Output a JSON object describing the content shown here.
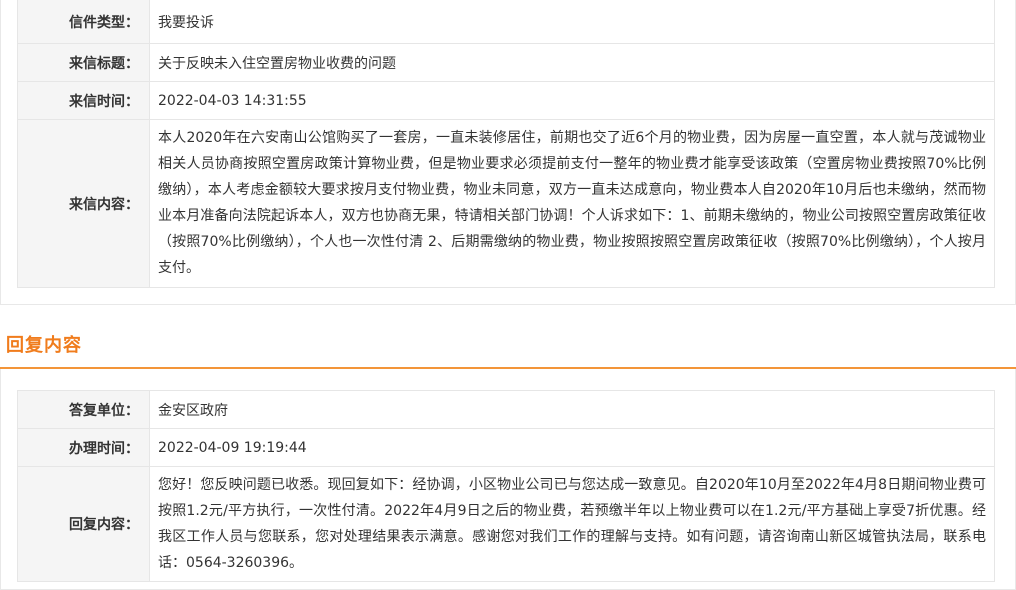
{
  "letter": {
    "type_label": "信件类型：",
    "type_value": "我要投诉",
    "title_label": "来信标题：",
    "title_value": "关于反映未入住空置房物业收费的问题",
    "time_label": "来信时间：",
    "time_value": "2022-04-03 14:31:55",
    "content_label": "来信内容：",
    "content_value": "本人2020年在六安南山公馆购买了一套房，一直未装修居住，前期也交了近6个月的物业费，因为房屋一直空置，本人就与茂诚物业相关人员协商按照空置房政策计算物业费，但是物业要求必须提前支付一整年的物业费才能享受该政策（空置房物业费按照70%比例缴纳），本人考虑金额较大要求按月支付物业费，物业未同意，双方一直未达成意向，物业费本人自2020年10月后也未缴纳，然而物业本月准备向法院起诉本人，双方也协商无果，特请相关部门协调！个人诉求如下：1、前期未缴纳的，物业公司按照空置房政策征收（按照70%比例缴纳），个人也一次性付清 2、后期需缴纳的物业费，物业按照按照空置房政策征收（按照70%比例缴纳），个人按月支付。"
  },
  "reply": {
    "section_title": "回复内容",
    "unit_label": "答复单位：",
    "unit_value": "金安区政府",
    "time_label": "办理时间：",
    "time_value": "2022-04-09 19:19:44",
    "content_label": "回复内容：",
    "content_value": "您好！您反映问题已收悉。现回复如下：经协调，小区物业公司已与您达成一致意见。自2020年10月至2022年4月8日期间物业费可按照1.2元/平方执行，一次性付清。2022年4月9日之后的物业费，若预缴半年以上物业费可以在1.2元/平方基础上享受7折优惠。经我区工作人员与您联系，您对处理结果表示满意。感谢您对我们工作的理解与支持。如有问题，请咨询南山新区城管执法局，联系电话：0564-3260396。"
  },
  "colors": {
    "accent": "#f07c1c",
    "label_bg": "#f5f5f5",
    "border": "#e6e6e6"
  }
}
